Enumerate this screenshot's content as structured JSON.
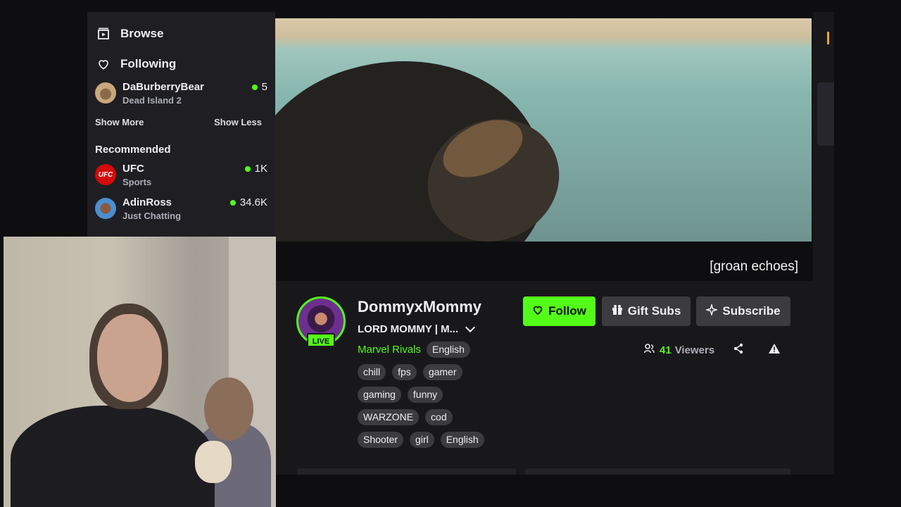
{
  "sidebar": {
    "nav": [
      {
        "label": "Browse",
        "icon": "browse-icon"
      },
      {
        "label": "Following",
        "icon": "heart-icon"
      }
    ],
    "following": [
      {
        "name": "DaBurberryBear",
        "category": "Dead Island 2",
        "viewers": "5"
      }
    ],
    "show_more": "Show More",
    "show_less": "Show Less",
    "recommended_title": "Recommended",
    "recommended": [
      {
        "name": "UFC",
        "category": "Sports",
        "viewers": "1K"
      },
      {
        "name": "AdinRoss",
        "category": "Just Chatting",
        "viewers": "34.6K"
      }
    ]
  },
  "video": {
    "caption": "[groan echoes]"
  },
  "stream": {
    "live_badge": "LIVE",
    "streamer": "DommyxMommy",
    "title": "LORD MOMMY | M...",
    "category": "Marvel Rivals",
    "language_tag": "English",
    "tags": [
      "chill",
      "fps",
      "gamer",
      "gaming",
      "funny",
      "WARZONE",
      "cod",
      "Shooter",
      "girl",
      "English"
    ],
    "follow_label": "Follow",
    "gift_label": "Gift Subs",
    "subscribe_label": "Subscribe",
    "viewer_count": "41",
    "viewers_label": "Viewers"
  },
  "colors": {
    "accent": "#53fc18",
    "panel": "#1f1f23",
    "background": "#0e0e10"
  }
}
